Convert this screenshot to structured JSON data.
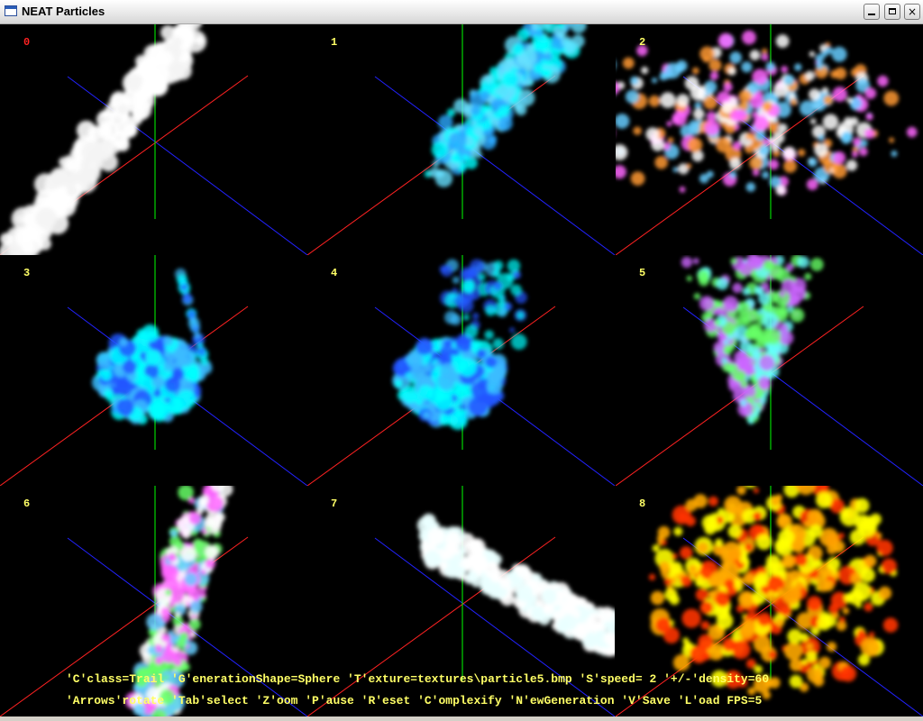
{
  "window": {
    "title": "NEAT Particles",
    "minimize_glyph": "",
    "maximize_glyph": "",
    "close_glyph": "×"
  },
  "viewports": [
    {
      "label": "0",
      "label_color": "#ff2222",
      "particle_colors": [
        "#ffffff",
        "#f4f4f4"
      ],
      "shape": "ribbon-diagonal"
    },
    {
      "label": "1",
      "label_color": "#ffff66",
      "particle_colors": [
        "#00ffff",
        "#2aa9ff",
        "#66e0ff"
      ],
      "shape": "spray"
    },
    {
      "label": "2",
      "label_color": "#ffff66",
      "particle_colors": [
        "#ff66ff",
        "#ffffff",
        "#66ccff",
        "#ff9933"
      ],
      "shape": "burst"
    },
    {
      "label": "3",
      "label_color": "#ffff66",
      "particle_colors": [
        "#00ffff",
        "#2255ff",
        "#3bbcff"
      ],
      "shape": "blob"
    },
    {
      "label": "4",
      "label_color": "#ffff66",
      "particle_colors": [
        "#00ffff",
        "#2255ff",
        "#3bbcff"
      ],
      "shape": "blob2"
    },
    {
      "label": "5",
      "label_color": "#ffff66",
      "particle_colors": [
        "#66ff66",
        "#66ffff",
        "#cc66ff"
      ],
      "shape": "cone"
    },
    {
      "label": "6",
      "label_color": "#ffff66",
      "particle_colors": [
        "#ff66ff",
        "#66ff66",
        "#ffffff",
        "#66ccff"
      ],
      "shape": "coil"
    },
    {
      "label": "7",
      "label_color": "#ffff66",
      "particle_colors": [
        "#ffffff",
        "#eaffff"
      ],
      "shape": "beams"
    },
    {
      "label": "8",
      "label_color": "#ffff66",
      "particle_colors": [
        "#ffff00",
        "#ffaa00",
        "#ff3300"
      ],
      "shape": "firework"
    }
  ],
  "axes": {
    "x_color": "#ff2222",
    "y_color": "#00ff00",
    "z_color": "#2222ff"
  },
  "status": {
    "line1": "'C'class=Trail 'G'enerationShape=Sphere 'T'exture=textures\\particle5.bmp 'S'speed= 2 '+/-'density=60",
    "line2": "'Arrows'rotate 'Tab'select 'Z'oom 'P'ause 'R'eset 'C'omplexify 'N'ewGeneration 'V'Save 'L'oad FPS=5"
  }
}
